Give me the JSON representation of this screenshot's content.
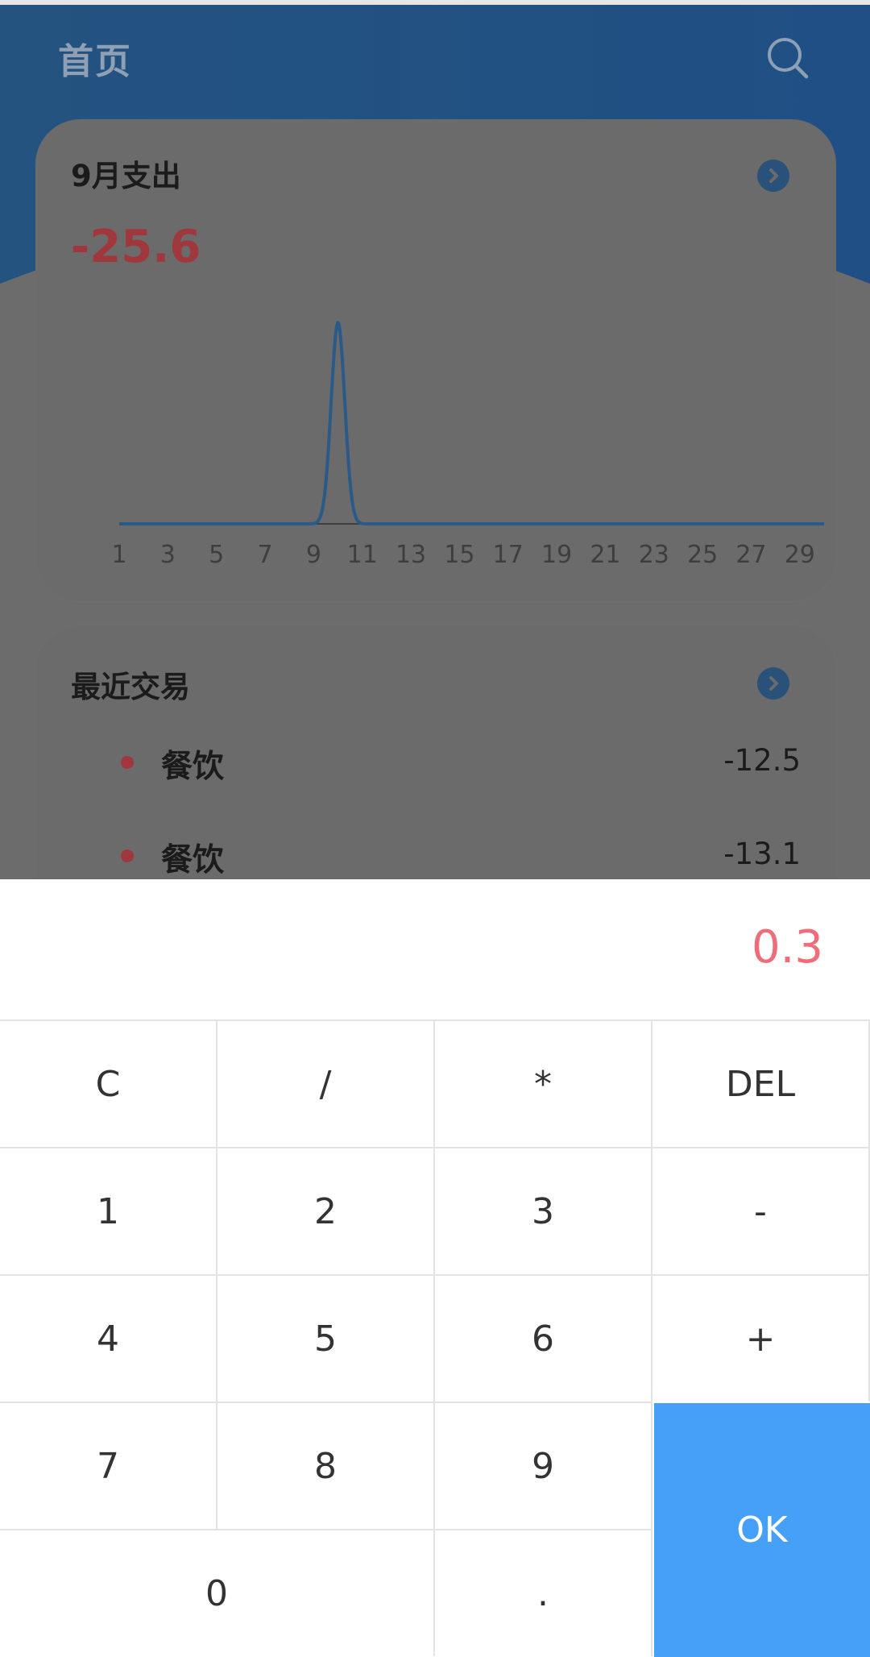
{
  "header": {
    "title": "首页",
    "search_icon": "search-icon"
  },
  "colors": {
    "header_blue": "#1f4f7c",
    "expense_red": "#a0373d",
    "ok_blue": "#46a0f8",
    "display_red": "#ef6c7a"
  },
  "expense_card": {
    "title": "9月支出",
    "amount": "-25.6",
    "arrow_icon": "chevron-right-icon"
  },
  "chart_data": {
    "type": "line",
    "title": "",
    "xlabel": "",
    "ylabel": "",
    "x": [
      1,
      2,
      3,
      4,
      5,
      6,
      7,
      8,
      9,
      10,
      11,
      12,
      13,
      14,
      15,
      16,
      17,
      18,
      19,
      20,
      21,
      22,
      23,
      24,
      25,
      26,
      27,
      28,
      29,
      30
    ],
    "series": [
      {
        "values": [
          0,
          0,
          0,
          0,
          0,
          0,
          0,
          0,
          0,
          25.6,
          0,
          0,
          0,
          0,
          0,
          0,
          0,
          0,
          0,
          0,
          0,
          0,
          0,
          0,
          0,
          0,
          0,
          0,
          0,
          0
        ]
      }
    ],
    "xtick_labels": [
      "1",
      "3",
      "5",
      "7",
      "9",
      "11",
      "13",
      "15",
      "17",
      "19",
      "21",
      "23",
      "25",
      "27",
      "29"
    ],
    "xlim": [
      1,
      30
    ],
    "ylim": [
      0,
      25.6
    ],
    "grid": false,
    "legend": "none"
  },
  "recent_card": {
    "title": "最近交易",
    "arrow_icon": "chevron-right-icon",
    "transactions": [
      {
        "category": "餐饮",
        "amount": "-12.5"
      },
      {
        "category": "餐饮",
        "amount": "-13.1"
      }
    ]
  },
  "keypad": {
    "display": "0.3",
    "keys": {
      "clear": "C",
      "divide": "/",
      "multiply": "*",
      "delete": "DEL",
      "one": "1",
      "two": "2",
      "three": "3",
      "minus": "-",
      "four": "4",
      "five": "5",
      "six": "6",
      "plus": "+",
      "seven": "7",
      "eight": "8",
      "nine": "9",
      "zero": "0",
      "dot": ".",
      "ok": "OK"
    }
  }
}
